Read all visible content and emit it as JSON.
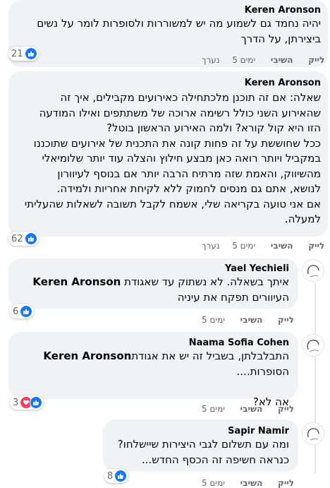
{
  "comments": [
    {
      "author": "Keren Aronson",
      "lines": [
        "יהיה נחמד גם לשמוע מה יש למשוררות ולסופרות לומר על נשים",
        "ביצירתן, על הדרך"
      ],
      "reaction_count": "21",
      "actions": {
        "like": "לייק",
        "reply": "השיבי",
        "time": "5 ימים",
        "edited": "נערך"
      }
    },
    {
      "author": "Keren Aronson",
      "lines": [
        "שאלה: אם זה תוכנן מלכתחילה כאירועים מקבילים, איך זה",
        "שהאירוע השני כולל רשימה ארוכה של משתתפים ואילו המודעה",
        "הזו היא קול קורא? ולמה האירוע הראשון בוטל?",
        "ככל שחוששת על זה פחות קונה את התכנית של אירועים שתוכננו",
        "במקביל ויותר רואה כאן מבצע חילוץ והצלה עוד יותר שלומיאלי",
        "מהשיווק, והאמת שזה מרתיח הרבה יותר אם בנוסף לעיוורון",
        "לנושא, אתם גם מנסים לחמוק ללא לקיחת אחריות ולמידה.",
        "אם אני טועה בקריאה שלי, אשמח לקבל תשובה לשאלות שהעליתי",
        "למעלה."
      ],
      "reaction_count": "62",
      "actions": {
        "like": "לייק",
        "reply": "השיבי",
        "time": "5 ימים",
        "edited": "נערך"
      }
    },
    {
      "author": "Yael Yechieli",
      "lines": [
        "Keren Aronson איתך בשאלה. לא נשתוק עד שאגודת",
        "העיוורים תפקח את עיניה"
      ],
      "mention": "Keren Aronson",
      "reaction_count": "6",
      "actions": {
        "like": "לייק",
        "reply": "השיבי",
        "time": "5 ימים"
      }
    },
    {
      "author": "Naama Sofia Cohen",
      "lines": [
        "Keren Aronsonהתבלבלתן, בשביל זה יש את אגודת",
        "הסופרות....",
        "",
        "אה לא?"
      ],
      "mention": "Keren Aronson",
      "reaction_count": "3",
      "actions": {
        "like": "לייק",
        "reply": "השיבי",
        "time": "5 ימים"
      }
    },
    {
      "author": "Sapir Namir",
      "lines": [
        "ומה עם תשלום לגבי היצירות שיישלחו?",
        "כנראה חשיפה זה הכסף החדש..."
      ],
      "reaction_count": "8",
      "actions": {
        "like": "לייק",
        "reply": "השיבי",
        "time": "5 ימים"
      }
    }
  ],
  "colors": {
    "bubble": "#f0f2f5",
    "like_blue": "#1877f2",
    "love_red": "#f33e58",
    "meta_grey": "#65676b"
  }
}
